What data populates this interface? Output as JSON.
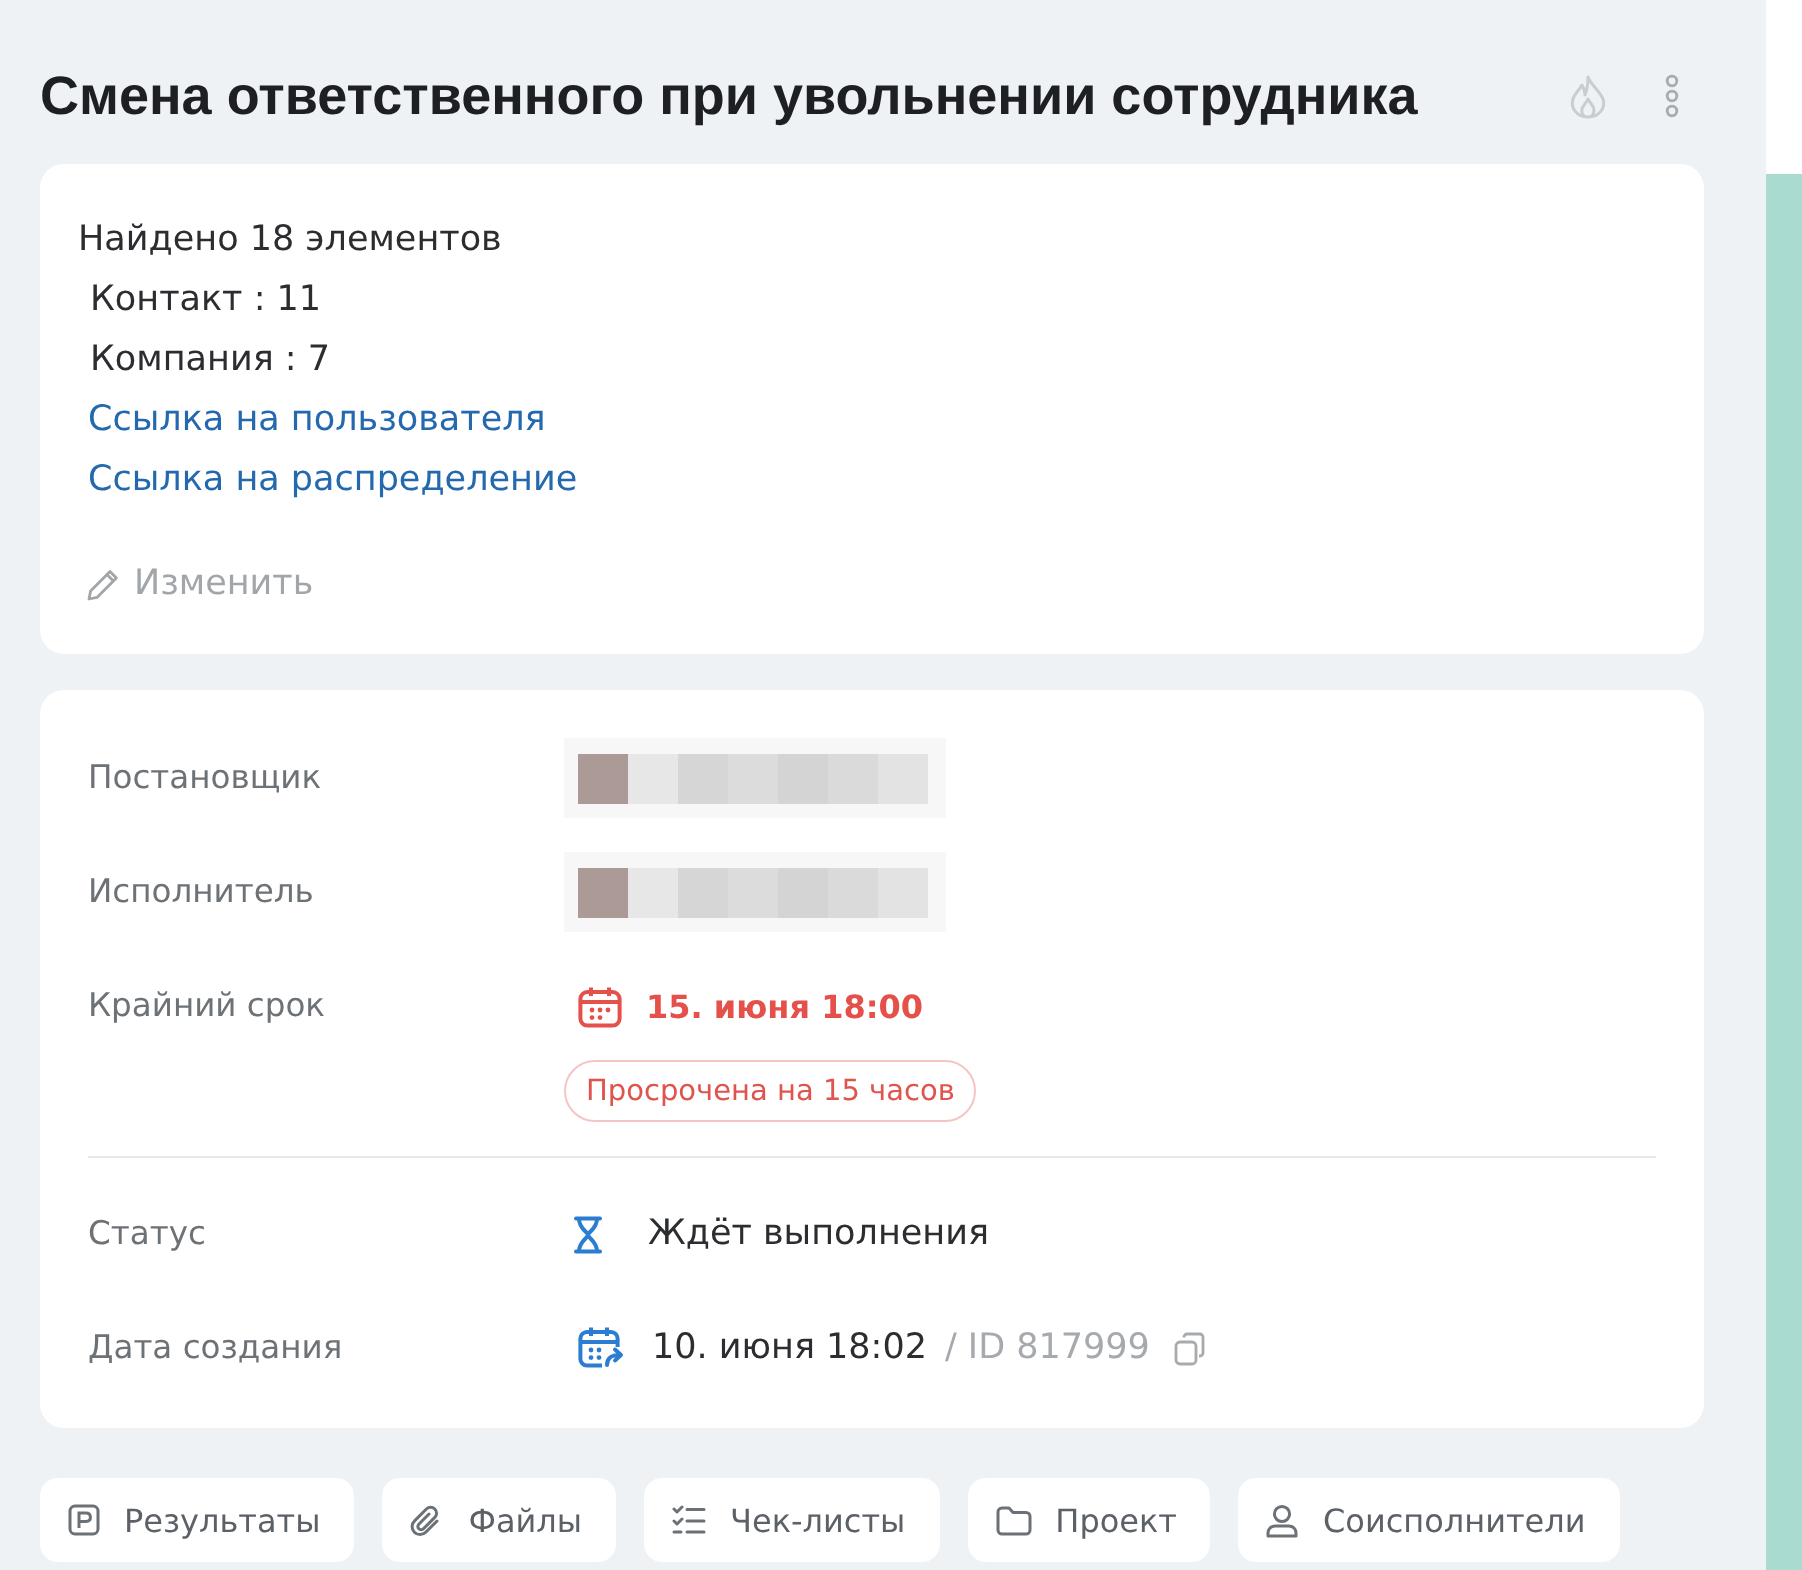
{
  "header": {
    "title": "Смена ответственного при увольнении сотрудника"
  },
  "summary": {
    "lines": [
      {
        "kind": "heading",
        "text": "Найдено 18 элементов"
      },
      {
        "kind": "count",
        "text": "Контакт : 11"
      },
      {
        "kind": "count",
        "text": "Компания : 7"
      },
      {
        "kind": "link",
        "text": "Ссылка на пользователя"
      },
      {
        "kind": "link",
        "text": "Ссылка на распределение"
      }
    ],
    "edit_label": "Изменить"
  },
  "details": {
    "sections": [
      {
        "rows": [
          {
            "kind": "person",
            "label": "Постановщик"
          },
          {
            "kind": "person",
            "label": "Исполнитель"
          },
          {
            "kind": "deadline",
            "label": "Крайний срок",
            "value": "15. июня 18:00",
            "overdue": true,
            "badge": "Просрочена на 15 часов"
          }
        ]
      },
      {
        "rows": [
          {
            "kind": "status",
            "label": "Статус",
            "value": "Ждёт выполнения"
          },
          {
            "kind": "created",
            "label": "Дата создания",
            "value": "10. июня 18:02",
            "id": "/ ID 817999"
          }
        ]
      }
    ]
  },
  "actions": [
    {
      "kind": "results",
      "label": "Результаты"
    },
    {
      "kind": "files",
      "label": "Файлы"
    },
    {
      "kind": "checklists",
      "label": "Чек-листы"
    },
    {
      "kind": "project",
      "label": "Проект"
    },
    {
      "kind": "people",
      "label": "Соисполнители"
    }
  ]
}
